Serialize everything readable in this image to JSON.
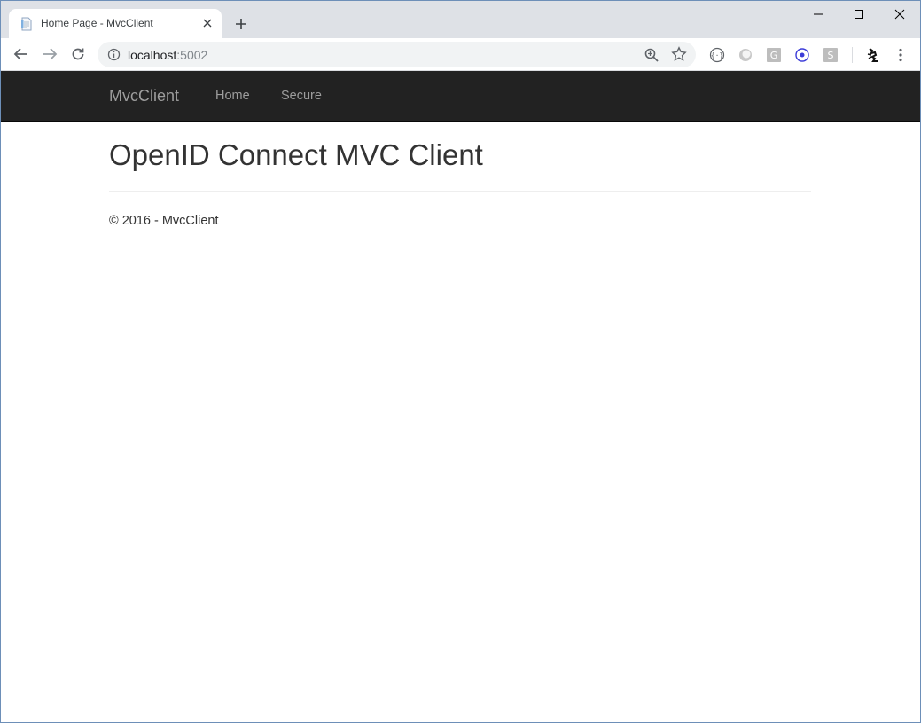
{
  "browser": {
    "tab": {
      "title": "Home Page - MvcClient",
      "favicon": "page-icon"
    },
    "new_tab_label": "+",
    "window_controls": [
      "minimize-icon",
      "maximize-icon",
      "close-icon"
    ],
    "address": {
      "host": "localhost",
      "port": ":5002"
    },
    "toolbar_icons": [
      "back-icon",
      "forward-icon",
      "reload-icon",
      "info-icon",
      "zoom-icon",
      "star-icon",
      "extension-icons",
      "profile-icon",
      "menu-icon"
    ]
  },
  "site": {
    "brand": "MvcClient",
    "nav": {
      "home": "Home",
      "secure": "Secure"
    },
    "heading": "OpenID Connect MVC Client",
    "footer": "© 2016 - MvcClient"
  },
  "colors": {
    "navbar_bg": "#222222",
    "navbar_text": "#9d9d9d",
    "tabstrip_bg": "#dee1e6",
    "text": "#333333"
  }
}
